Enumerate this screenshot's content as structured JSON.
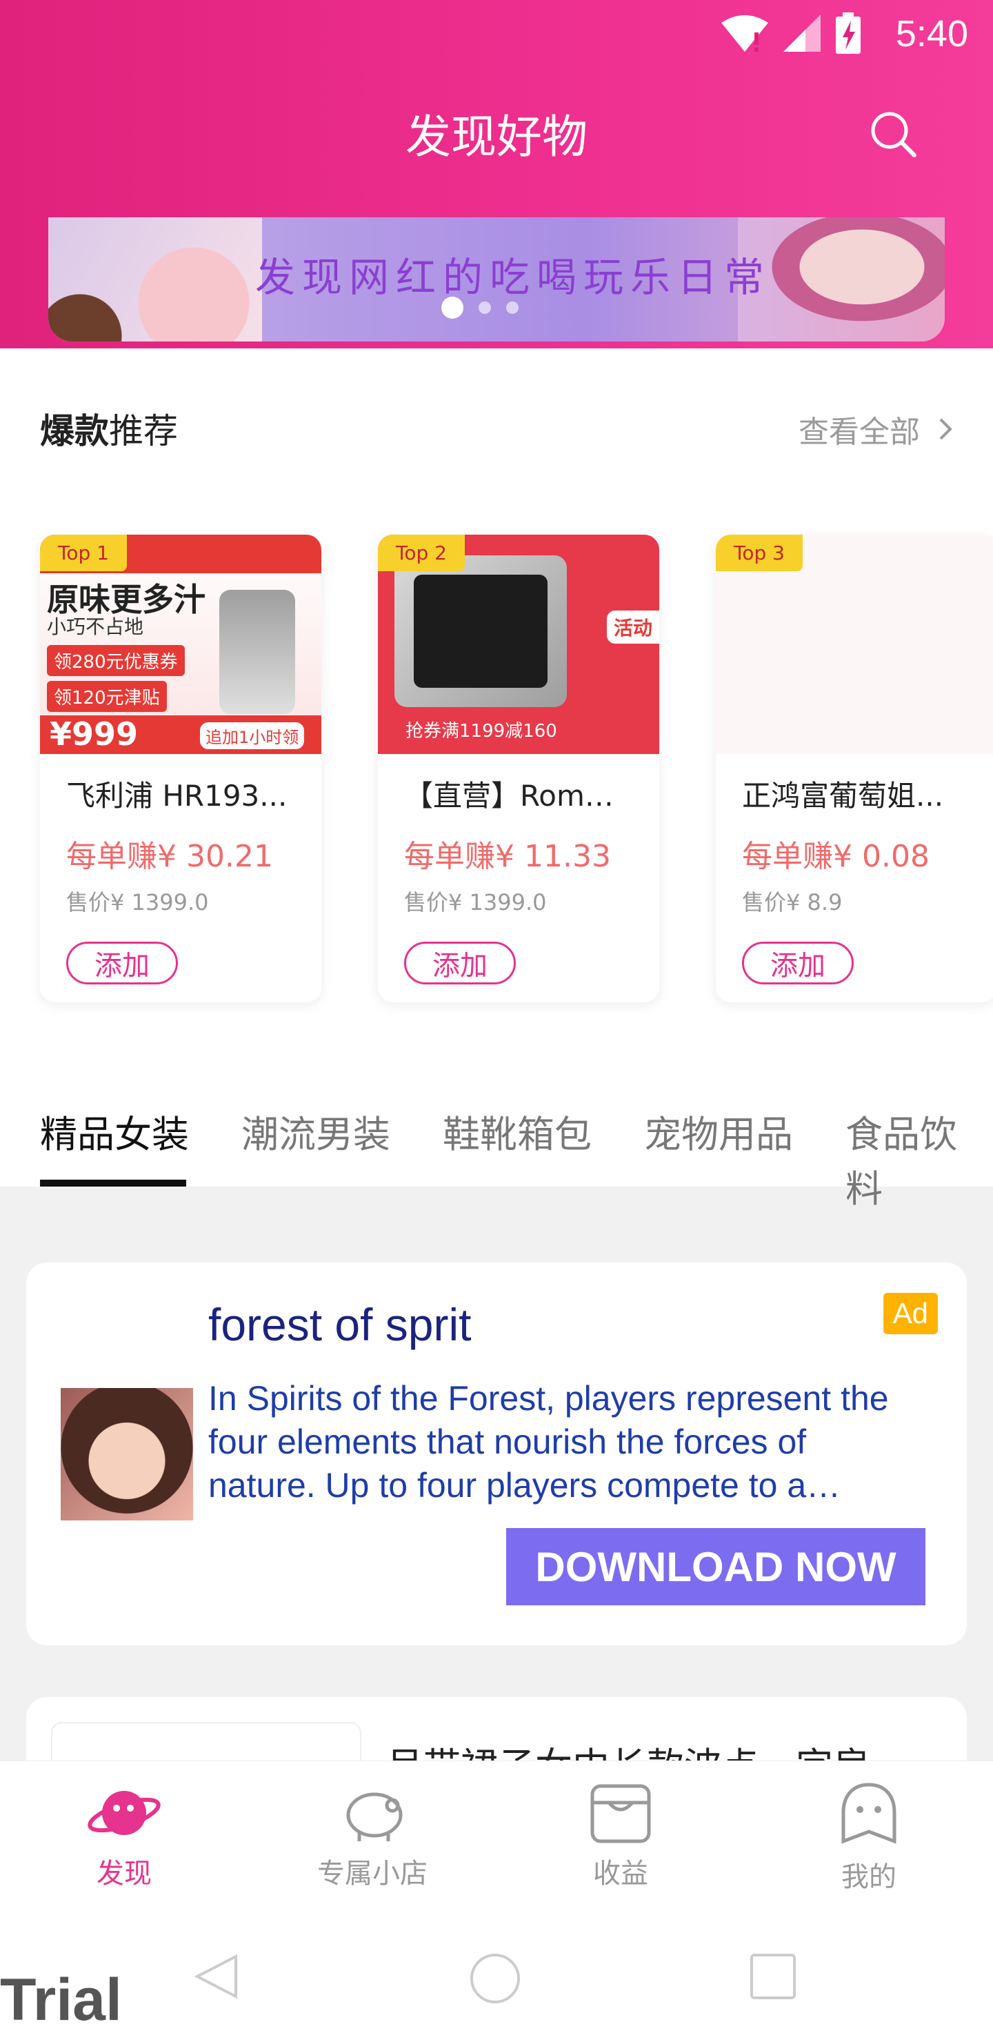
{
  "status": {
    "time": "5:40"
  },
  "header": {
    "title": "发现好物"
  },
  "banner": {
    "text": "发现网红的吃喝玩乐日常"
  },
  "hot": {
    "title_bold": "爆款",
    "title_rest": "推荐",
    "see_all": "查看全部",
    "products": [
      {
        "rank": "Top 1",
        "name": "飞利浦 HR193...",
        "earn": "每单赚¥ 30.21",
        "price": "售价¥  1399.0",
        "add": "添加"
      },
      {
        "rank": "Top 2",
        "name": "【直营】Romm...",
        "earn": "每单赚¥ 11.33",
        "price": "售价¥  1399.0",
        "add": "添加"
      },
      {
        "rank": "Top 3",
        "name": "正鸿富葡萄姐...",
        "earn": "每单赚¥ 0.08",
        "price": "售价¥  8.9",
        "add": "添加"
      }
    ],
    "p1_img": {
      "l1": "原味更多汁",
      "l2": "小巧不占地",
      "l3": "领280元优惠券",
      "l4": "领120元津贴",
      "price": "¥999",
      "tag": "追加1小时领"
    },
    "p2_img": {
      "promo": "活动",
      "bottom": "抢券满1199减160"
    }
  },
  "tabs": [
    "精品女装",
    "潮流男装",
    "鞋靴箱包",
    "宠物用品",
    "食品饮料"
  ],
  "ad": {
    "title": "forest of sprit",
    "tag": "Ad",
    "description": "In Spirits of the Forest, players represent the four elements that nourish the forces of nature. Up to four players compete to a…",
    "cta": "DOWNLOAD NOW"
  },
  "next_item": {
    "title": "吊带裙子女中长款波点一字肩"
  },
  "bottom_nav": [
    {
      "label": "发现",
      "icon": "planet-icon",
      "active": true
    },
    {
      "label": "专属小店",
      "icon": "piggy-bank-icon",
      "active": false
    },
    {
      "label": "收益",
      "icon": "box-icon",
      "active": false
    },
    {
      "label": "我的",
      "icon": "user-face-icon",
      "active": false
    }
  ],
  "watermark": "Trial",
  "colors": {
    "accent": "#e5338e",
    "earn": "#f06a6a",
    "header": "#e0227c",
    "ad_button": "#7c6cf0"
  }
}
